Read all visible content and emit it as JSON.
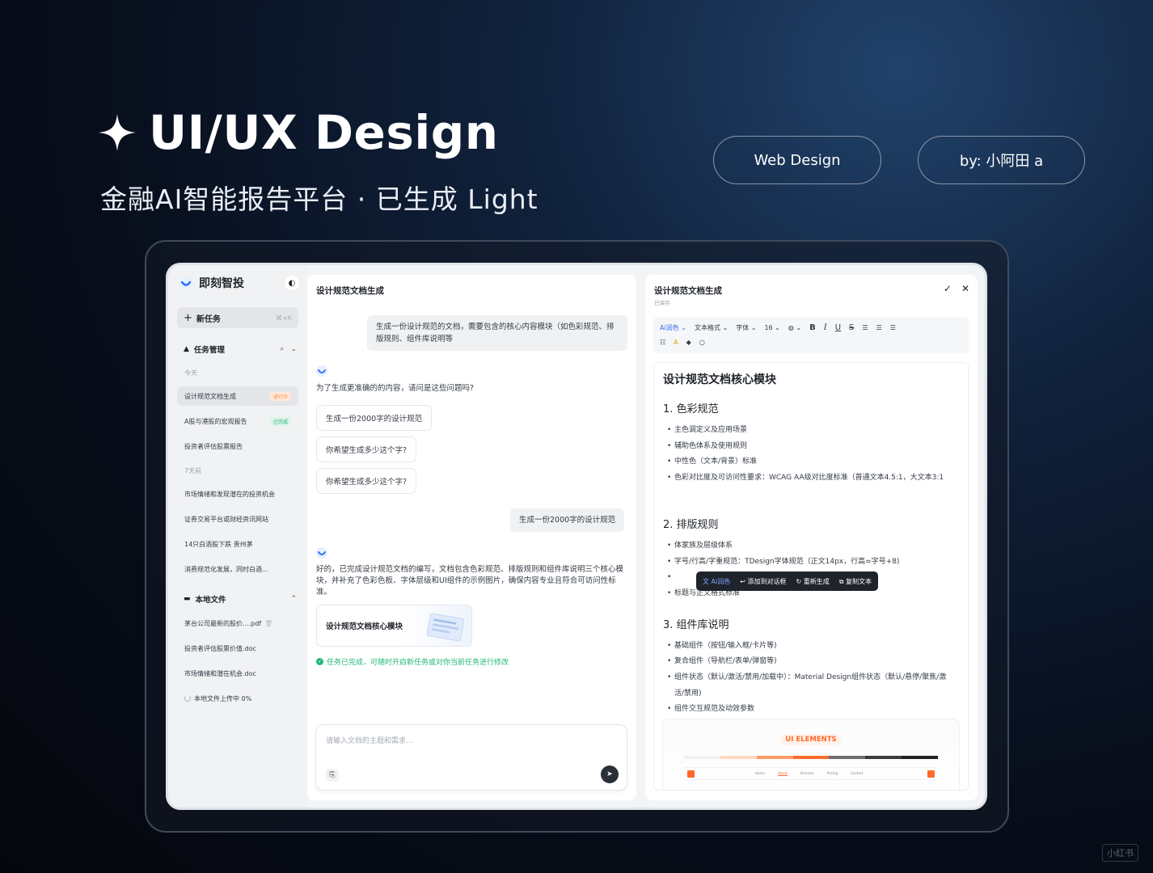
{
  "hero": {
    "title": "UI/UX Design",
    "subtitle": "金融AI智能报告平台 · 已生成 Light",
    "tag_web": "Web Design",
    "tag_author": "by: 小阿田 a"
  },
  "sidebar": {
    "brand": "即刻智投",
    "new_task": "新任务",
    "new_task_shortcut": "⌘+K",
    "task_section": "任务管理",
    "group_today": "今天",
    "today_items": [
      {
        "label": "设计规范文档生成",
        "tag": "进行中"
      },
      {
        "label": "A股与港股的宏观报告",
        "tag": "已完成"
      },
      {
        "label": "投资者评估股票报告",
        "tag": ""
      }
    ],
    "group_week": "7天前",
    "week_items": [
      "市场情绪和发现潜在的投资机会",
      "证券交易平台或财经资讯网站",
      "14只白酒股下跌 贵州茅",
      "消费规范化发展，同时白酒..."
    ],
    "files_section": "本地文件",
    "files": [
      "茅台公司最新的股价....pdf",
      "投资者评估股票价值.doc",
      "市场情绪和潜在机会.doc"
    ],
    "upload_status": "本地文件上传中 0%"
  },
  "chat": {
    "title": "设计规范文档生成",
    "user_msg_1": "生成一份设计规范的文档，需要包含的核心内容模块（如色彩规范、排版规则、组件库说明等",
    "bot_question": "为了生成更准确的的内容，请问是这些问题吗?",
    "options": [
      "生成一份2000字的设计规范",
      "你希望生成多少这个字?",
      "你希望生成多少这个字?"
    ],
    "user_msg_2": "生成一份2000字的设计规范",
    "bot_answer": "好的，已完成设计规范文档的编写，文档包含色彩规范、排版规则和组件库说明三个核心模块，并补充了色彩色板、字体层级和UI组件的示例图片，确保内容专业且符合可访问性标准。",
    "doc_card": "设计规范文档核心模块",
    "done_msg": "任务已完成，可随时开启新任务或对你当前任务进行修改",
    "input_placeholder": "请输入文档的主题和需求..."
  },
  "editor": {
    "title": "设计规范文档生成",
    "saved": "已保存",
    "toolbar": {
      "ai_polish": "Ai润色",
      "text_format": "文本格式",
      "font": "字体",
      "size": "16"
    },
    "doc_title": "设计规范文档核心模块",
    "sections": [
      {
        "heading": "1. 色彩规范",
        "items": [
          "主色调定义及应用场景",
          "辅助色体系及使用规则",
          "中性色（文本/背景）标准",
          "色彩对比度及可访问性要求：WCAG AA级对比度标准（普通文本4.5:1，大文本3:1"
        ]
      },
      {
        "heading": "2. 排版规则",
        "items": [
          "体家族及层级体系",
          "字号/行高/字重规范：TDesign字体规范（正文14px，行高=字号+8)",
          "",
          "标题与正文格式标准"
        ]
      },
      {
        "heading": "3. 组件库说明",
        "items": [
          "基础组件（按钮/输入框/卡片等)",
          "复合组件（导航栏/表单/弹窗等)",
          "组件状态（默认/激活/禁用/加载中）：Material Design组件状态（默认/悬停/聚焦/激活/禁用)",
          "组件交互规范及动效参数"
        ]
      }
    ],
    "float_bar": {
      "ai": "Ai润色",
      "add": "添加到对话框",
      "regen": "重新生成",
      "copy": "复制文本"
    },
    "ui_elements_label": "UI ELEMENTS",
    "ui_nav_links": [
      "Home",
      "About",
      "Services",
      "Pricing",
      "Contact"
    ]
  },
  "watermark": "小红书",
  "colors": {
    "accent_orange": "#ff6a2b",
    "success": "#20b87a",
    "ai_blue": "#2f6df6"
  }
}
